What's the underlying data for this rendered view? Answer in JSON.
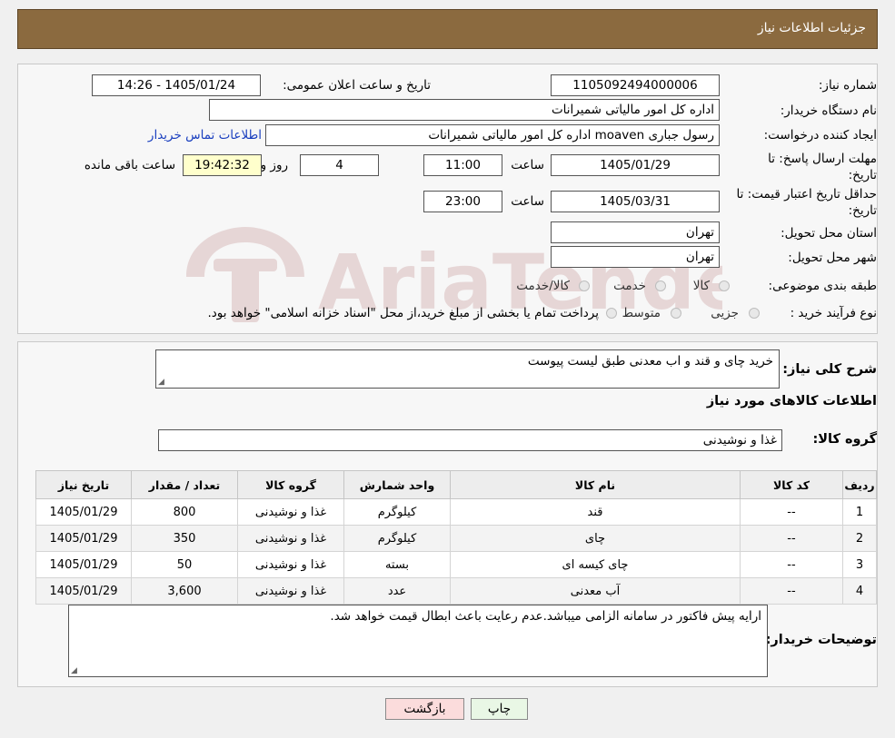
{
  "header": {
    "title": "جزئیات اطلاعات نیاز"
  },
  "form": {
    "need_number": {
      "label": "شماره نیاز:",
      "value": "1105092494000006"
    },
    "announce": {
      "label": "تاریخ و ساعت اعلان عمومی:",
      "value": "1405/01/24 - 14:26"
    },
    "buyer": {
      "label": "نام دستگاه خریدار:",
      "value": "اداره کل امور مالیاتی شمیرانات"
    },
    "creator": {
      "label": "ایجاد کننده درخواست:",
      "value": "رسول جباری moaven اداره کل امور مالیاتی شمیرانات",
      "contact_link": "اطلاعات تماس خریدار"
    },
    "reply_deadline": {
      "label": "مهلت ارسال پاسخ: تا تاریخ:",
      "date": "1405/01/29",
      "time_label": "ساعت",
      "time": "11:00",
      "days": "4",
      "days_label": "روز و",
      "remaining": "19:42:32",
      "remaining_label": "ساعت باقی مانده"
    },
    "price_validity": {
      "label": "حداقل تاریخ اعتبار قیمت: تا تاریخ:",
      "date": "1405/03/31",
      "time_label": "ساعت",
      "time": "23:00"
    },
    "province": {
      "label": "استان محل تحویل:",
      "value": "تهران"
    },
    "city": {
      "label": "شهر محل تحویل:",
      "value": "تهران"
    },
    "category": {
      "label": "طبقه بندی موضوعی:",
      "options": [
        "کالا",
        "خدمت",
        "کالا/خدمت"
      ]
    },
    "purchase_type": {
      "label": "نوع فرآیند خرید :",
      "options": [
        "جزیی",
        "متوسط"
      ],
      "note": "پرداخت تمام یا بخشی از مبلغ خرید،از محل \"اسناد خزانه اسلامی\" خواهد بود."
    }
  },
  "details": {
    "description_label": "شرح کلی نیاز:",
    "description": "خرید چای و قند و اب معدنی طبق لیست پیوست",
    "goods_title": "اطلاعات کالاهای مورد نیاز",
    "group_label": "گروه کالا:",
    "group_value": "غذا و نوشیدنی",
    "table": {
      "headers": [
        "ردیف",
        "کد کالا",
        "نام کالا",
        "واحد شمارش",
        "گروه کالا",
        "تعداد / مقدار",
        "تاریخ نیاز"
      ],
      "rows": [
        [
          "1",
          "--",
          "قند",
          "کیلوگرم",
          "غذا و نوشیدنی",
          "800",
          "1405/01/29"
        ],
        [
          "2",
          "--",
          "چای",
          "کیلوگرم",
          "غذا و نوشیدنی",
          "350",
          "1405/01/29"
        ],
        [
          "3",
          "--",
          "چای کیسه ای",
          "بسته",
          "غذا و نوشیدنی",
          "50",
          "1405/01/29"
        ],
        [
          "4",
          "--",
          "آب معدنی",
          "عدد",
          "غذا و نوشیدنی",
          "3,600",
          "1405/01/29"
        ]
      ]
    },
    "buyer_notes_label": "توضیحات خریدار:",
    "buyer_notes": "ارایه پیش فاکتور در سامانه الزامی میباشد.عدم رعایت باعث ابطال قیمت خواهد شد."
  },
  "buttons": {
    "print": "چاپ",
    "back": "بازگشت"
  },
  "watermark": {
    "text": "AriaTender.neT"
  },
  "colors": {
    "header_bg": "#8b6a3f",
    "link": "#1a3fbf",
    "remaining_bg": "#ffffcc",
    "print_bg": "#e9f7e5",
    "back_bg": "#fbdcdc"
  }
}
